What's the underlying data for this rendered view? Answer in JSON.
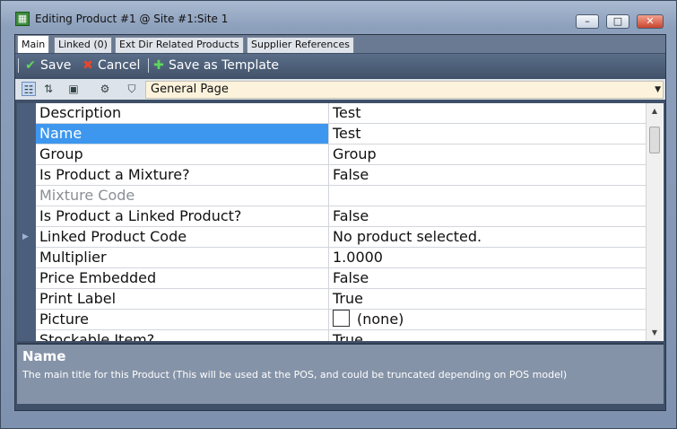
{
  "window": {
    "title": "Editing Product #1 @ Site #1:Site 1",
    "minimize_glyph": "–",
    "maximize_glyph": "□",
    "close_glyph": "✕"
  },
  "tabs": [
    {
      "label": "Main",
      "active": true
    },
    {
      "label": "Linked (0)",
      "active": false
    },
    {
      "label": "Ext Dir Related Products",
      "active": false
    },
    {
      "label": "Supplier References",
      "active": false
    }
  ],
  "toolbar": {
    "save_label": "Save",
    "cancel_label": "Cancel",
    "template_label": "Save as Template",
    "save_icon": "check-icon",
    "cancel_icon": "x-icon",
    "template_icon": "plus-icon"
  },
  "page_selector": {
    "value": "General Page"
  },
  "properties": [
    {
      "name": "Description",
      "value": "Test"
    },
    {
      "name": "Name",
      "value": "Test",
      "selected": true
    },
    {
      "name": "Group",
      "value": "Group"
    },
    {
      "name": "Is Product a Mixture?",
      "value": "False"
    },
    {
      "name": "Mixture Code",
      "value": "",
      "disabled": true
    },
    {
      "name": "Is Product a Linked Product?",
      "value": "False"
    },
    {
      "name": "Linked Product Code",
      "value": "No product selected."
    },
    {
      "name": "Multiplier",
      "value": "1.0000"
    },
    {
      "name": "Price Embedded",
      "value": "False"
    },
    {
      "name": "Print Label",
      "value": "True"
    },
    {
      "name": "Picture",
      "value": "(none)"
    },
    {
      "name": "Stockable Item?",
      "value": "True"
    }
  ],
  "help": {
    "title": "Name",
    "description": "The main title for this Product (This will be used at the POS, and could be truncated depending on POS model)"
  },
  "colors": {
    "selection": "#3d97ef",
    "toolbar": "#4b5d77",
    "page_combo": "#fdf3dc"
  }
}
